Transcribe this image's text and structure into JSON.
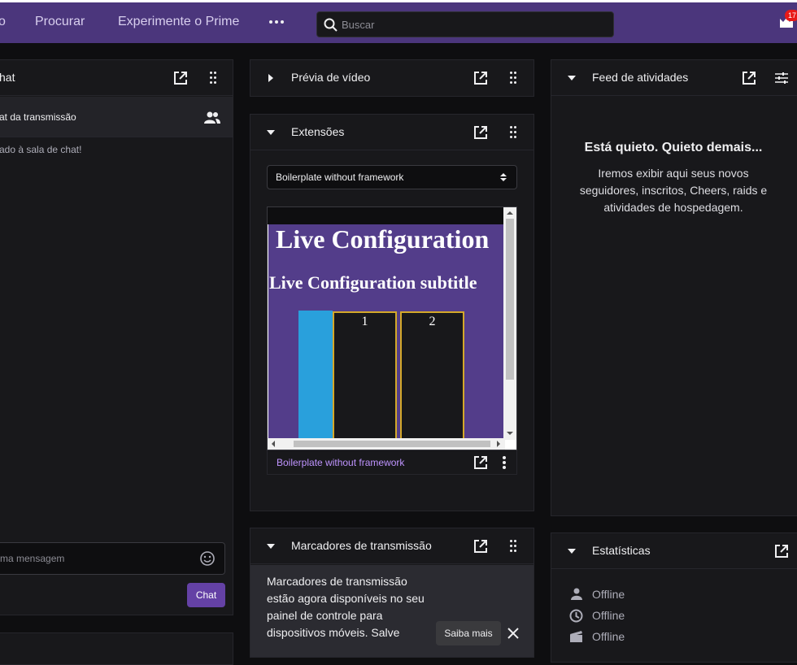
{
  "topbar": {
    "nav_partial": "o",
    "nav_browse": "Procurar",
    "nav_prime": "Experimente o Prime",
    "more_icon": "more-dots-icon",
    "search_placeholder": "Buscar",
    "prime_badge": "17"
  },
  "chat_panel": {
    "title": "hat",
    "subheader": "at da transmissão",
    "welcome": "ado à sala de chat!",
    "input_placeholder": "ma mensagem",
    "send_label": "Chat"
  },
  "video_preview": {
    "title": "Prévia de vídeo"
  },
  "extensions": {
    "title": "Extensões",
    "selected": "Boilerplate without framework",
    "content": {
      "heading": "Live Configuration",
      "subtitle": "Live Configuration subtitle",
      "cards": [
        "1",
        "2"
      ]
    },
    "footer_label": "Boilerplate without framework"
  },
  "stream_markers": {
    "title": "Marcadores de transmissão",
    "notice_lines": [
      "Marcadores de transmissão",
      "estão agora disponíveis no seu",
      "painel de controle para",
      "dispositivos móveis. Salve"
    ],
    "learn_more": "Saiba mais"
  },
  "activity_feed": {
    "title": "Feed de atividades",
    "empty_title": "Está quieto. Quieto demais...",
    "empty_lines": [
      "Iremos exibir aqui seus novos",
      "seguidores, inscritos, Cheers, raids e",
      "atividades de hospedagem."
    ]
  },
  "stats": {
    "title": "Estatísticas",
    "rows": [
      {
        "icon": "viewer-icon",
        "value": "Offline"
      },
      {
        "icon": "clock-icon",
        "value": "Offline"
      },
      {
        "icon": "clapper-icon",
        "value": "Offline"
      }
    ]
  },
  "colors": {
    "topbar": "#4b367c",
    "panel": "#18181b",
    "accent": "#6441a5",
    "extension_bg": "#533d8a"
  }
}
